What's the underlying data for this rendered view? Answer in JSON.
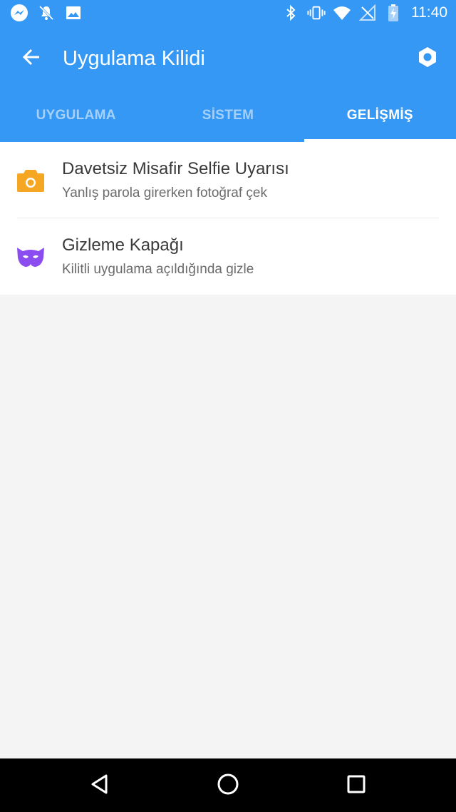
{
  "status_bar": {
    "time": "11:40",
    "left_icons": [
      "messenger-icon",
      "notifications-off-icon",
      "image-icon"
    ],
    "right_icons": [
      "bluetooth-icon",
      "vibrate-icon",
      "wifi-icon",
      "no-signal-icon",
      "battery-charging-icon"
    ]
  },
  "toolbar": {
    "title": "Uygulama Kilidi",
    "back_icon": "arrow-back-icon",
    "settings_icon": "hexagon-settings-icon"
  },
  "tabs": [
    {
      "label": "UYGULAMA",
      "active": false
    },
    {
      "label": "SİSTEM",
      "active": false
    },
    {
      "label": "GELİŞMİŞ",
      "active": true
    }
  ],
  "items": [
    {
      "title": "Davetsiz Misafir Selfie Uyarısı",
      "subtitle": "Yanlış parola girerken fotoğraf çek",
      "icon": "camera-icon",
      "icon_color": "#f5a623"
    },
    {
      "title": "Gizleme Kapağı",
      "subtitle": "Kilitli uygulama açıldığında gizle",
      "icon": "mask-icon",
      "icon_color": "#8b4cf0"
    }
  ],
  "colors": {
    "primary": "#3598f4",
    "background": "#f4f4f4"
  },
  "nav_bar": {
    "icons": [
      "back-triangle-icon",
      "home-circle-icon",
      "recents-square-icon"
    ]
  }
}
